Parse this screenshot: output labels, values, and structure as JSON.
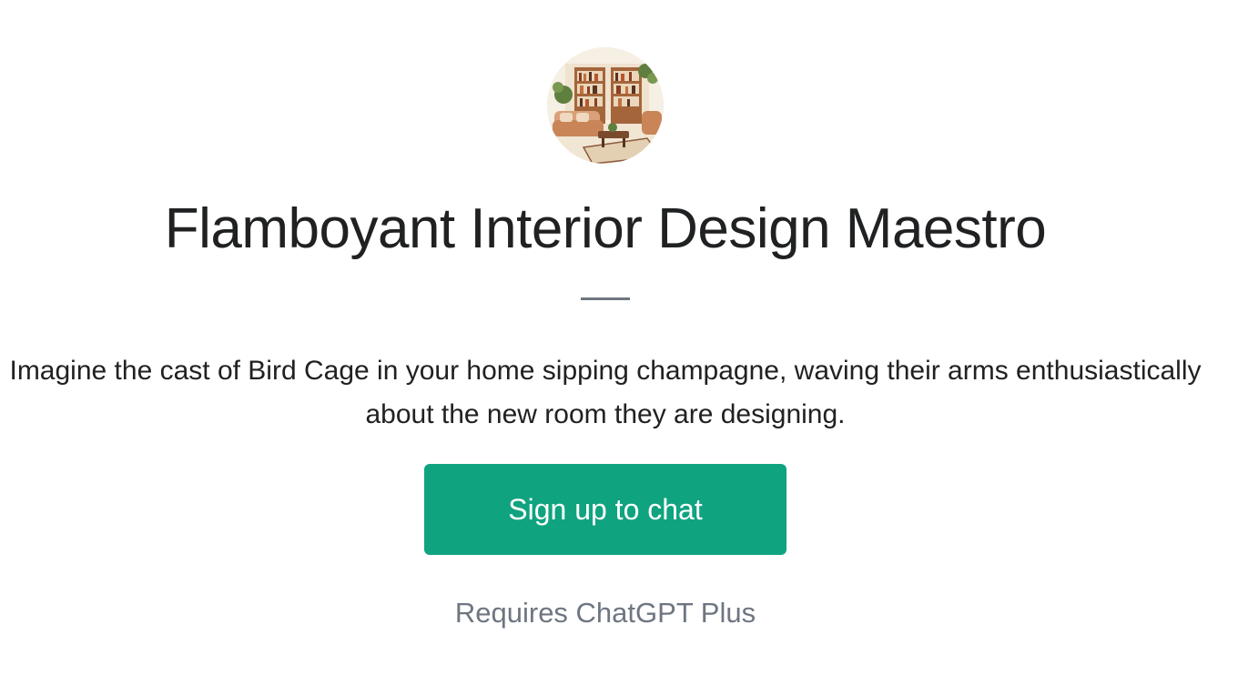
{
  "gpt": {
    "avatar_icon": "living-room-illustration",
    "title": "Flamboyant Interior Design Maestro",
    "description_line1": "Imagine the cast of Bird Cage in your home sipping champagne, waving their arms enthusiastically",
    "description_line2": "about the new room they are designing."
  },
  "actions": {
    "signup_label": "Sign up to chat"
  },
  "footer": {
    "requires_text": "Requires ChatGPT Plus"
  },
  "colors": {
    "accent": "#10a37f",
    "text": "#202123",
    "muted": "#6e7681"
  }
}
